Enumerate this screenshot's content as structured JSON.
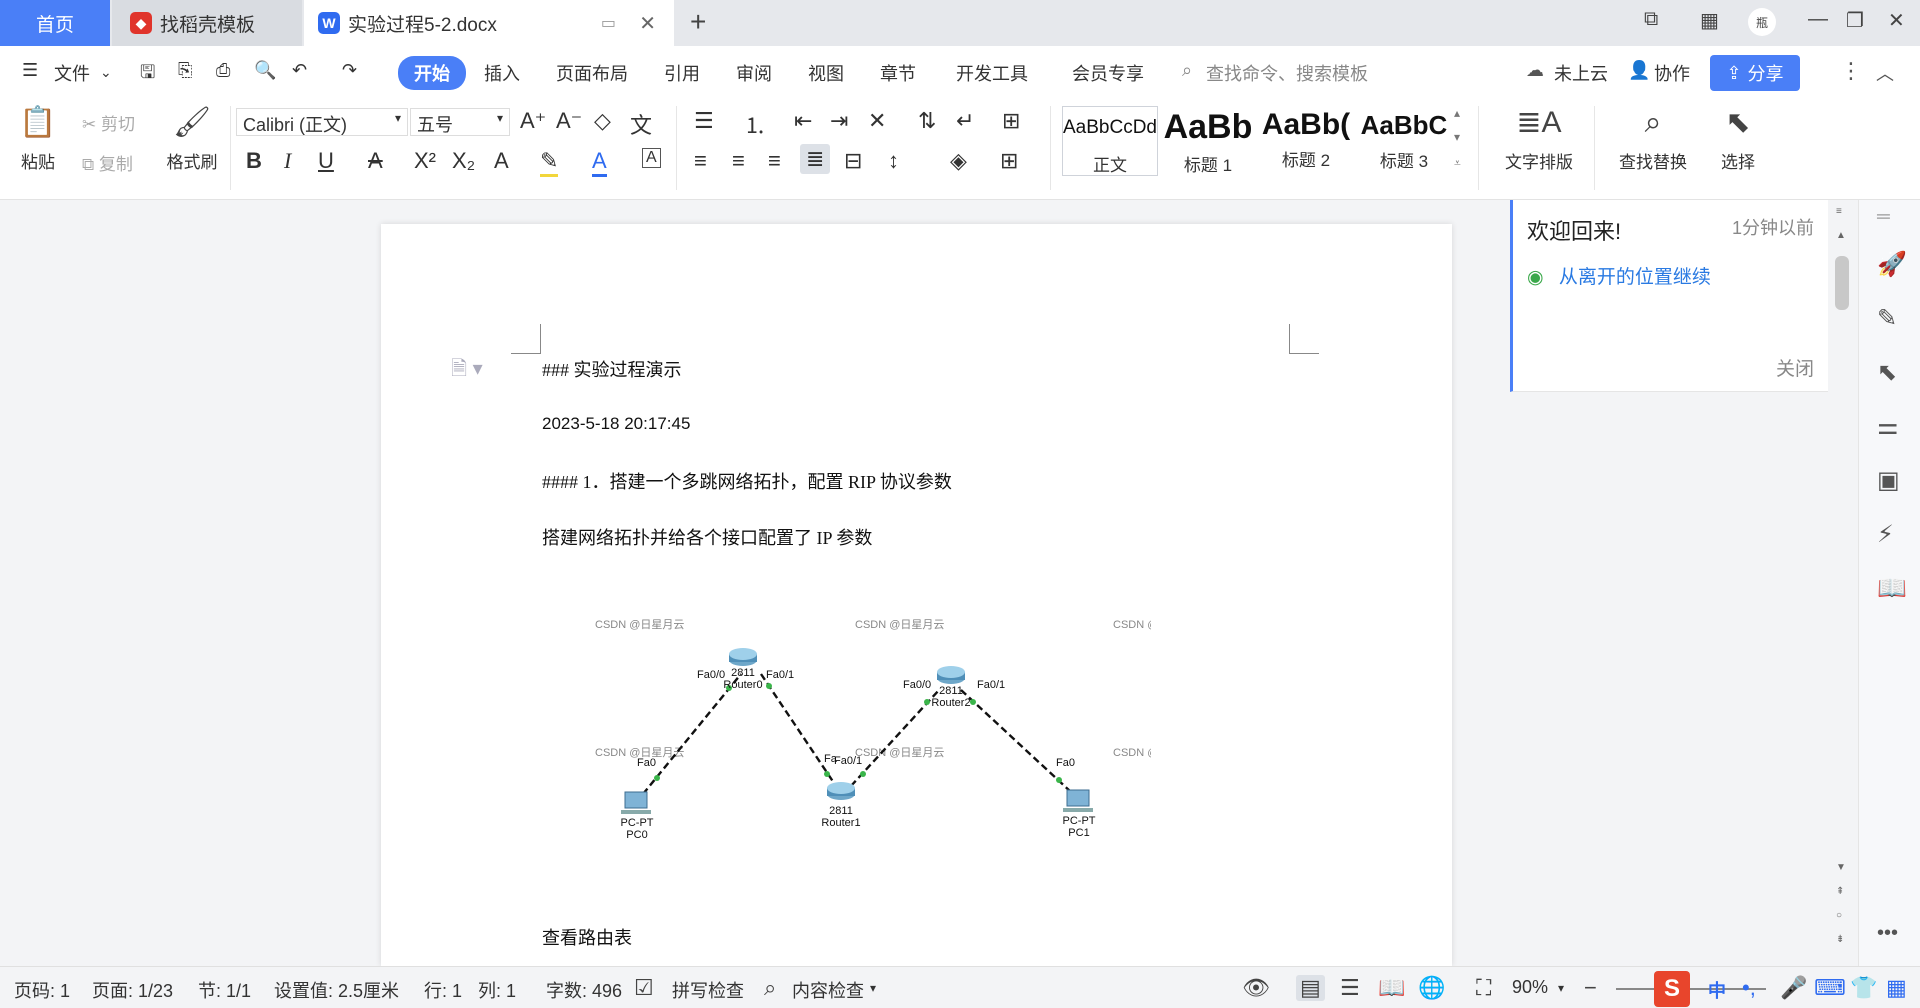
{
  "tabs": {
    "home": "首页",
    "templates": "找稻壳模板",
    "document": "实验过程5-2.docx",
    "new_tab": "+"
  },
  "window": {
    "avatar_text": "瓶"
  },
  "menu": {
    "file": "文件",
    "items": [
      "开始",
      "插入",
      "页面布局",
      "引用",
      "审阅",
      "视图",
      "章节",
      "开发工具",
      "会员专享"
    ],
    "search_placeholder": "查找命令、搜索模板",
    "cloud": "未上云",
    "collab": "协作",
    "share": "分享"
  },
  "ribbon": {
    "paste": "粘贴",
    "cut": "剪切",
    "copy": "复制",
    "format_painter": "格式刷",
    "font_name": "Calibri (正文)",
    "font_size": "五号",
    "styles": [
      {
        "sample": "AaBbCcDd",
        "label": "正文"
      },
      {
        "sample": "AaBb",
        "label": "标题 1"
      },
      {
        "sample": "AaBb(",
        "label": "标题 2"
      },
      {
        "sample": "AaBbC",
        "label": "标题 3"
      }
    ],
    "text_layout": "文字排版",
    "find_replace": "查找替换",
    "select": "选择"
  },
  "document": {
    "lines": [
      "###  实验过程演示",
      "2023-5-18 20:17:45",
      "#### 1．搭建一个多跳网络拓扑，配置 RIP 协议参数",
      "搭建网络拓扑并给各个接口配置了 IP 参数",
      "查看路由表"
    ],
    "figure": {
      "watermark": "CSDN @日星月云",
      "watermark_short": "CSDN @",
      "devices": [
        {
          "name": "PC0",
          "model": "PC-PT"
        },
        {
          "name": "Router0",
          "model": "2811"
        },
        {
          "name": "Router1",
          "model": "2811"
        },
        {
          "name": "Router2",
          "model": "2811"
        },
        {
          "name": "PC1",
          "model": "PC-PT"
        }
      ],
      "ports": {
        "pc0": "Fa0",
        "r0_left": "Fa0/0",
        "r0_right": "Fa0/1",
        "r1_left": "Fa",
        "r1_right": "Fa0/1",
        "r2_left": "Fa0/0",
        "r2_right": "Fa0/1",
        "pc1": "Fa0"
      }
    }
  },
  "notification": {
    "title": "欢迎回来!",
    "time": "1分钟以前",
    "link": "从离开的位置继续",
    "close": "关闭"
  },
  "status": {
    "page_code": "页码: 1",
    "page": "页面: 1/23",
    "section": "节: 1/1",
    "setting": "设置值: 2.5厘米",
    "row": "行: 1",
    "col": "列: 1",
    "word_count": "字数: 496",
    "spell_check": "拼写检查",
    "content_check": "内容检查",
    "zoom": "90%",
    "ime": "中"
  },
  "colors": {
    "accent": "#4a7ff7",
    "link": "#2a7ae2",
    "eye": "#3aa84a"
  }
}
